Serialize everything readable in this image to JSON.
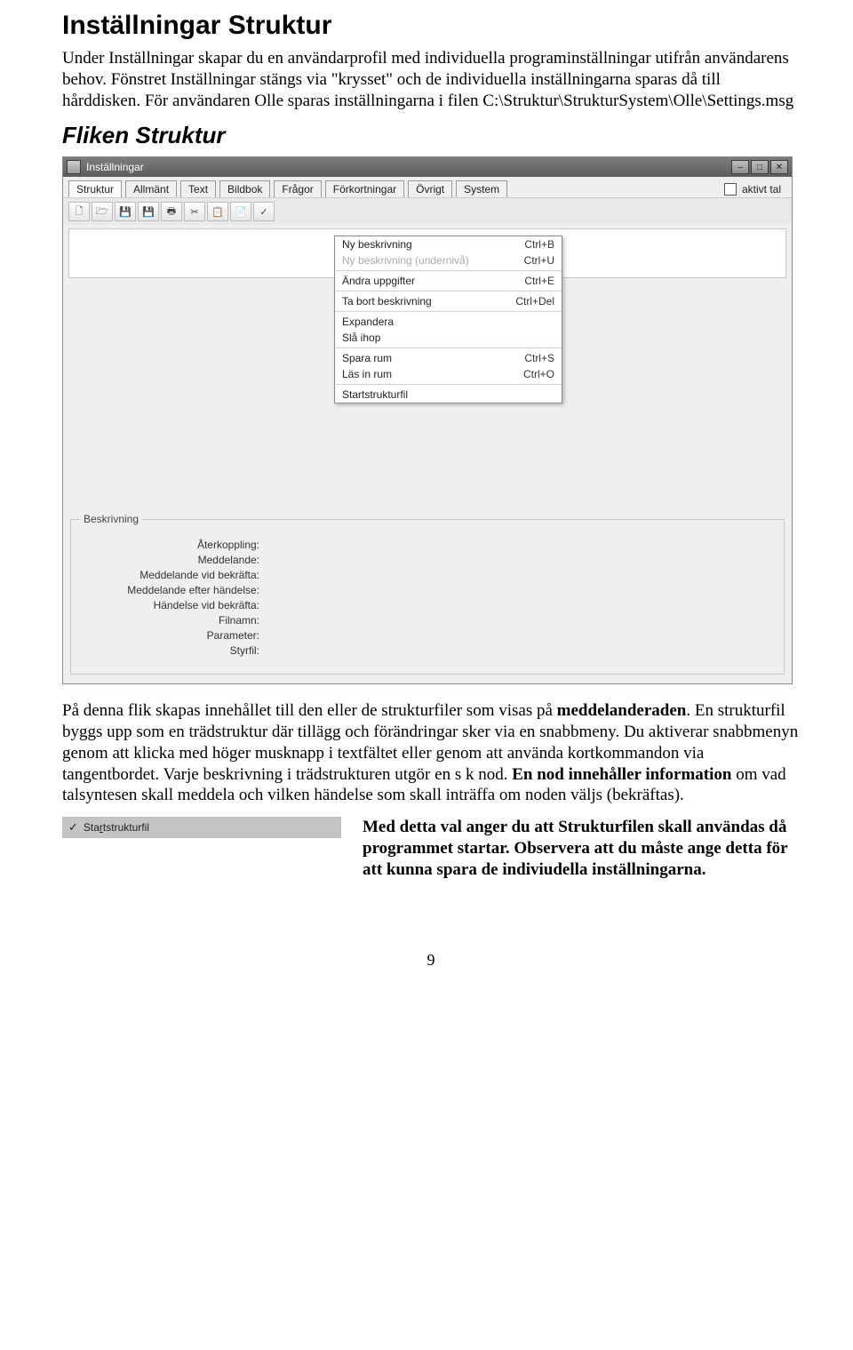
{
  "heading": "Inställningar Struktur",
  "intro": "Under Inställningar skapar du en användarprofil med individuella programinställningar utifrån användarens behov. Fönstret Inställningar stängs via \"krysset\" och de individuella inställningarna sparas då till hårddisken. För användaren Olle sparas inställningarna i filen C:\\Struktur\\StrukturSystem\\Olle\\Settings.msg",
  "subheading": "Fliken Struktur",
  "window": {
    "title": "Inställningar",
    "tabs": [
      "Struktur",
      "Allmänt",
      "Text",
      "Bildbok",
      "Frågor",
      "Förkortningar",
      "Övrigt",
      "System"
    ],
    "checkbox_label": "aktivt tal",
    "toolbar_glyphs": [
      "🗋",
      "🗁",
      "💾",
      "💾",
      "🖶",
      "✂",
      "📋",
      "📄",
      "✓"
    ],
    "context_menu": [
      {
        "label": "Ny beskrivning",
        "key": "Ctrl+B"
      },
      {
        "label": "Ny beskrivning (undernivå)",
        "key": "Ctrl+U",
        "disabled": true
      },
      {
        "sep": true
      },
      {
        "label": "Ändra uppgifter",
        "key": "Ctrl+E"
      },
      {
        "sep": true
      },
      {
        "label": "Ta bort beskrivning",
        "key": "Ctrl+Del"
      },
      {
        "sep": true
      },
      {
        "label": "Expandera",
        "key": ""
      },
      {
        "label": "Slå ihop",
        "key": ""
      },
      {
        "sep": true
      },
      {
        "label": "Spara rum",
        "key": "Ctrl+S"
      },
      {
        "label": "Läs in rum",
        "key": "Ctrl+O"
      },
      {
        "sep": true
      },
      {
        "label": "Startstrukturfil",
        "key": ""
      }
    ],
    "group": {
      "legend": "Beskrivning",
      "labels": [
        "Återkoppling:",
        "Meddelande:",
        "Meddelande vid bekräfta:",
        "Meddelande efter händelse:",
        "Händelse vid bekräfta:",
        "Filnamn:",
        "Parameter:",
        "Styrfil:"
      ]
    }
  },
  "para2a": "På denna flik skapas innehållet till den eller de strukturfiler som visas på ",
  "para2b": "meddelanderaden",
  "para2c": ". En strukturfil byggs upp som en trädstruktur där tillägg och förändringar sker via en snabbmeny. Du aktiverar snabbmenyn genom att klicka med höger musknapp i textfältet eller genom att använda kortkommandon via tangentbordet. Varje beskrivning i trädstrukturen utgör en s k nod. ",
  "para2d": "En nod innehåller information",
  "para2e": " om vad talsyntesen skall meddela och vilken händelse som skall inträffa om noden väljs (bekräftas).",
  "thumb_label": "Startstrukturfil",
  "option_text_a": "Med detta val anger du att Strukturfilen skall användas då programmet startar. Observera att du måste ange detta för att kunna spara de indiviudella inställningarna.",
  "page_number": "9"
}
